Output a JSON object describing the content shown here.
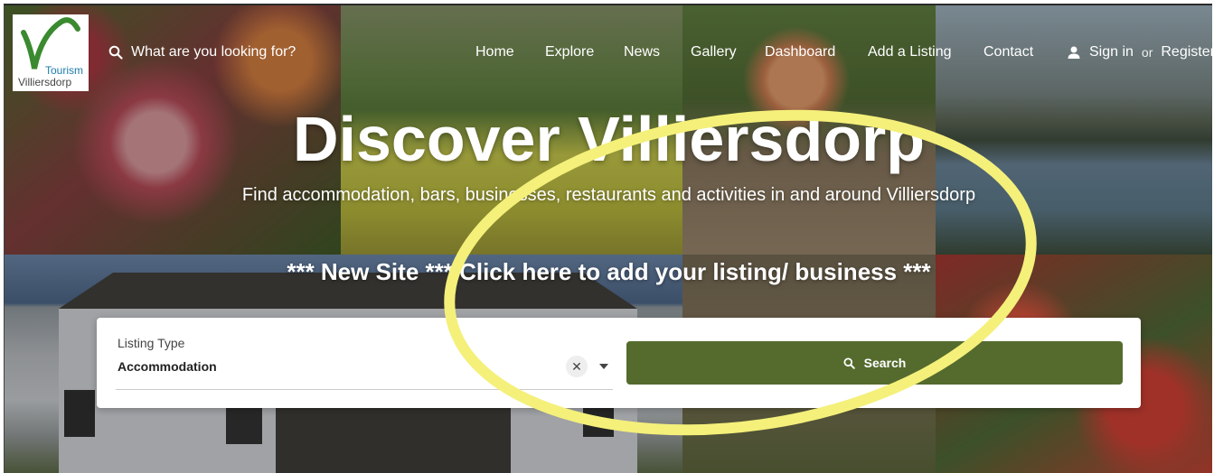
{
  "logo": {
    "line1": "Tourism",
    "line2": "Villiersdorp"
  },
  "header": {
    "search_placeholder": "What are you looking for?",
    "nav": [
      "Home",
      "Explore",
      "News",
      "Gallery",
      "Dashboard",
      "Add a Listing",
      "Contact"
    ],
    "sign_in": "Sign in",
    "or": "or",
    "register": "Register"
  },
  "hero": {
    "title": "Discover Villiersdorp",
    "subtitle": "Find accommodation, bars, businesses, restaurants and activities in and around Villiersdorp",
    "promo": "*** New Site *** Click here to add your listing/ business ***"
  },
  "search_form": {
    "field_label": "Listing Type",
    "field_value": "Accommodation",
    "clear_symbol": "✕",
    "button_label": "Search"
  },
  "colors": {
    "accent_green": "#546b2d",
    "highlight_yellow": "#f4f07a",
    "logo_blue": "#1e7ca8"
  },
  "icons": [
    "search-icon",
    "user-icon",
    "close-icon",
    "caret-down-icon"
  ]
}
